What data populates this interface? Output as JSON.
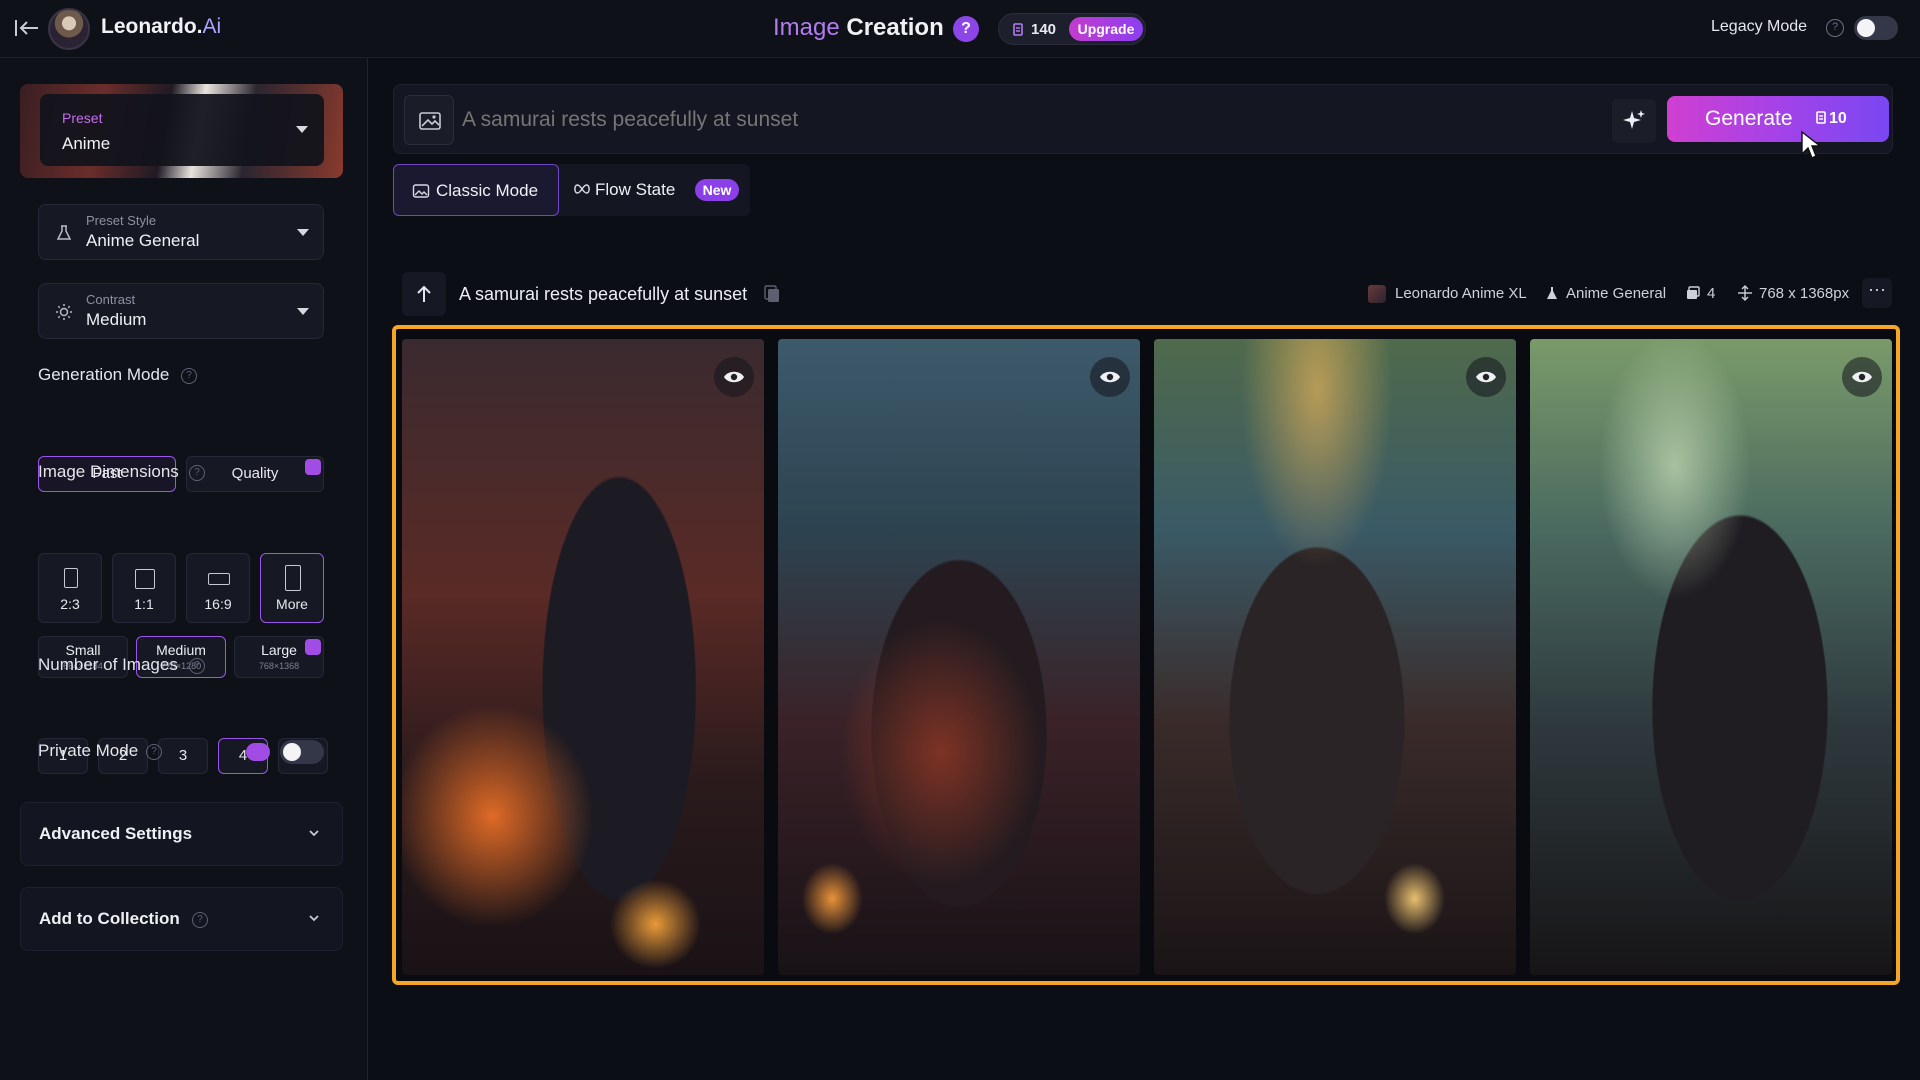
{
  "header": {
    "brand_name": "Leonardo.",
    "brand_suffix": "Ai",
    "title_accent": "Image",
    "title_main": "Creation",
    "help_label": "?",
    "token_count": "140",
    "upgrade_label": "Upgrade",
    "legacy_mode_label": "Legacy Mode",
    "legacy_mode_on": false
  },
  "sidebar": {
    "preset": {
      "label": "Preset",
      "value": "Anime"
    },
    "preset_style": {
      "label": "Preset Style",
      "value": "Anime General"
    },
    "contrast": {
      "label": "Contrast",
      "value": "Medium"
    },
    "generation_mode": {
      "label": "Generation Mode",
      "options": [
        "Fast",
        "Quality"
      ],
      "selected": "Fast"
    },
    "image_dimensions": {
      "label": "Image Dimensions",
      "ratios": [
        "2:3",
        "1:1",
        "16:9",
        "More"
      ],
      "selected_ratio": "More",
      "sizes": [
        {
          "name": "Small",
          "dims": "664×1184"
        },
        {
          "name": "Medium",
          "dims": "720×1280"
        },
        {
          "name": "Large",
          "dims": "768×1368"
        }
      ],
      "selected_size": "Medium"
    },
    "number_of_images": {
      "label": "Number of Images",
      "options": [
        "1",
        "2",
        "3",
        "4"
      ],
      "selected": "4"
    },
    "private_mode": {
      "label": "Private Mode",
      "on": false
    },
    "advanced_settings_label": "Advanced Settings",
    "add_to_collection_label": "Add to Collection"
  },
  "prompt": {
    "placeholder": "A samurai rests peacefully at sunset",
    "generate_label": "Generate",
    "generate_cost": "10"
  },
  "mode_tabs": {
    "classic": "Classic Mode",
    "flow_state": "Flow State",
    "new_badge": "New"
  },
  "generation": {
    "prompt": "A samurai rests peacefully at sunset",
    "model": "Leonardo Anime XL",
    "style": "Anime General",
    "image_count": "4",
    "resolution": "768 x 1368px",
    "images": [
      {
        "name": "samurai-image-1"
      },
      {
        "name": "samurai-image-2"
      },
      {
        "name": "samurai-image-3"
      },
      {
        "name": "samurai-image-4"
      }
    ]
  },
  "colors": {
    "accent_purple": "#9a55ea",
    "generate_gradient_start": "#d03fd1",
    "selection_border": "#f5a623",
    "background": "#0c0e15"
  },
  "icons": [
    "back-arrow-icon",
    "help-icon",
    "token-icon",
    "image-prompt-icon",
    "sparkle-icon",
    "flask-icon",
    "sun-icon",
    "gem-icon",
    "up-arrow-icon",
    "copy-icon",
    "eye-icon",
    "chevron-down-icon",
    "more-icon"
  ]
}
